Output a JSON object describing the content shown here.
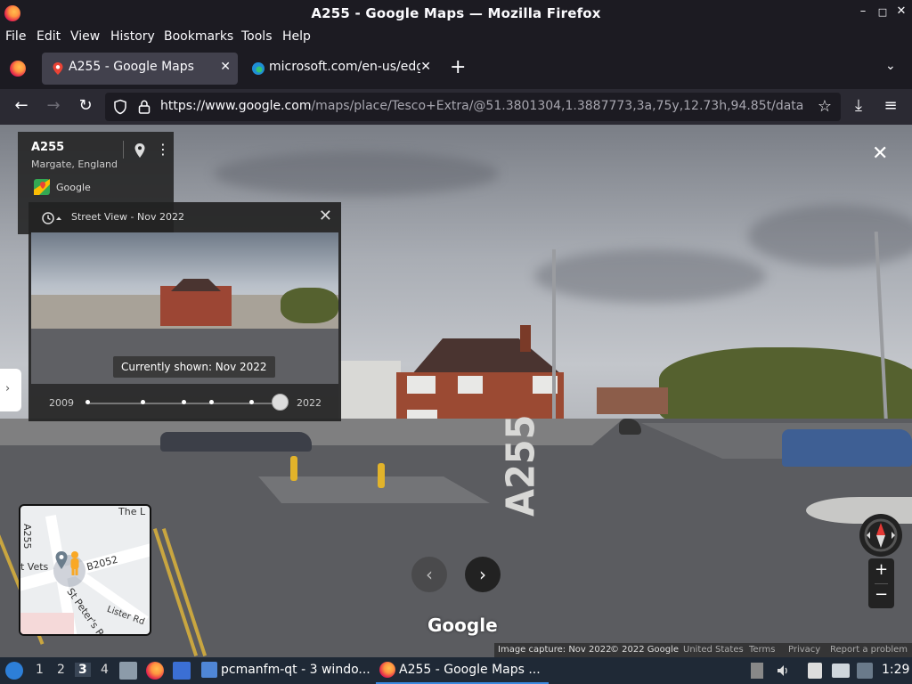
{
  "window": {
    "title": "A255 - Google Maps — Mozilla Firefox",
    "minimize": "–",
    "maximize": "□",
    "close": "✕"
  },
  "menu": [
    "File",
    "Edit",
    "View",
    "History",
    "Bookmarks",
    "Tools",
    "Help"
  ],
  "tabs": [
    {
      "label": "A255 - Google Maps",
      "active": true,
      "close": "✕"
    },
    {
      "label": "microsoft.com/en-us/edg",
      "active": false,
      "close": "✕"
    }
  ],
  "tabstrip": {
    "new_tab": "+",
    "list_all": "⌄"
  },
  "nav": {
    "back": "←",
    "forward": "→",
    "reload": "↻",
    "url_host": "https://www.google.com",
    "url_path": "/maps/place/Tesco+Extra/@51.3801304,1.3887773,3a,75y,12.73h,94.85t/data",
    "bookmark": "☆",
    "downloads": "⤓",
    "menu": "≡"
  },
  "place_card": {
    "name": "A255",
    "region": "Margate, England",
    "provider": "Google",
    "more": "⋮"
  },
  "time_travel": {
    "title": "Street View - Nov 2022",
    "close": "✕",
    "tooltip": "Currently shown: Nov 2022",
    "start_year": "2009",
    "end_year": "2022",
    "selected_fraction": 1.0
  },
  "scene": {
    "close": "✕",
    "prev": "‹",
    "next": "›",
    "logo": "Google",
    "road_marking": "A255"
  },
  "minimap": {
    "labels": [
      "The L",
      "A255",
      "t Vets",
      "B2052",
      "St Peter's R",
      "Lister Rd"
    ]
  },
  "zoom": {
    "in": "+",
    "out": "−"
  },
  "attribution": {
    "capture": "Image capture: Nov 2022",
    "copyright": "© 2022 Google",
    "country": "United States",
    "terms": "Terms",
    "privacy": "Privacy",
    "report": "Report a problem"
  },
  "taskbar": {
    "workspaces": [
      "1",
      "2",
      "3",
      "4"
    ],
    "tasks": [
      {
        "label": "pcmanfm-qt - 3 windo..."
      },
      {
        "label": "A255 - Google Maps ..."
      }
    ],
    "clock": "1:29"
  },
  "colors": {
    "accent": "#3b8ae0",
    "titlebar": "#1c1b22",
    "toolbar": "#2b2a33"
  }
}
